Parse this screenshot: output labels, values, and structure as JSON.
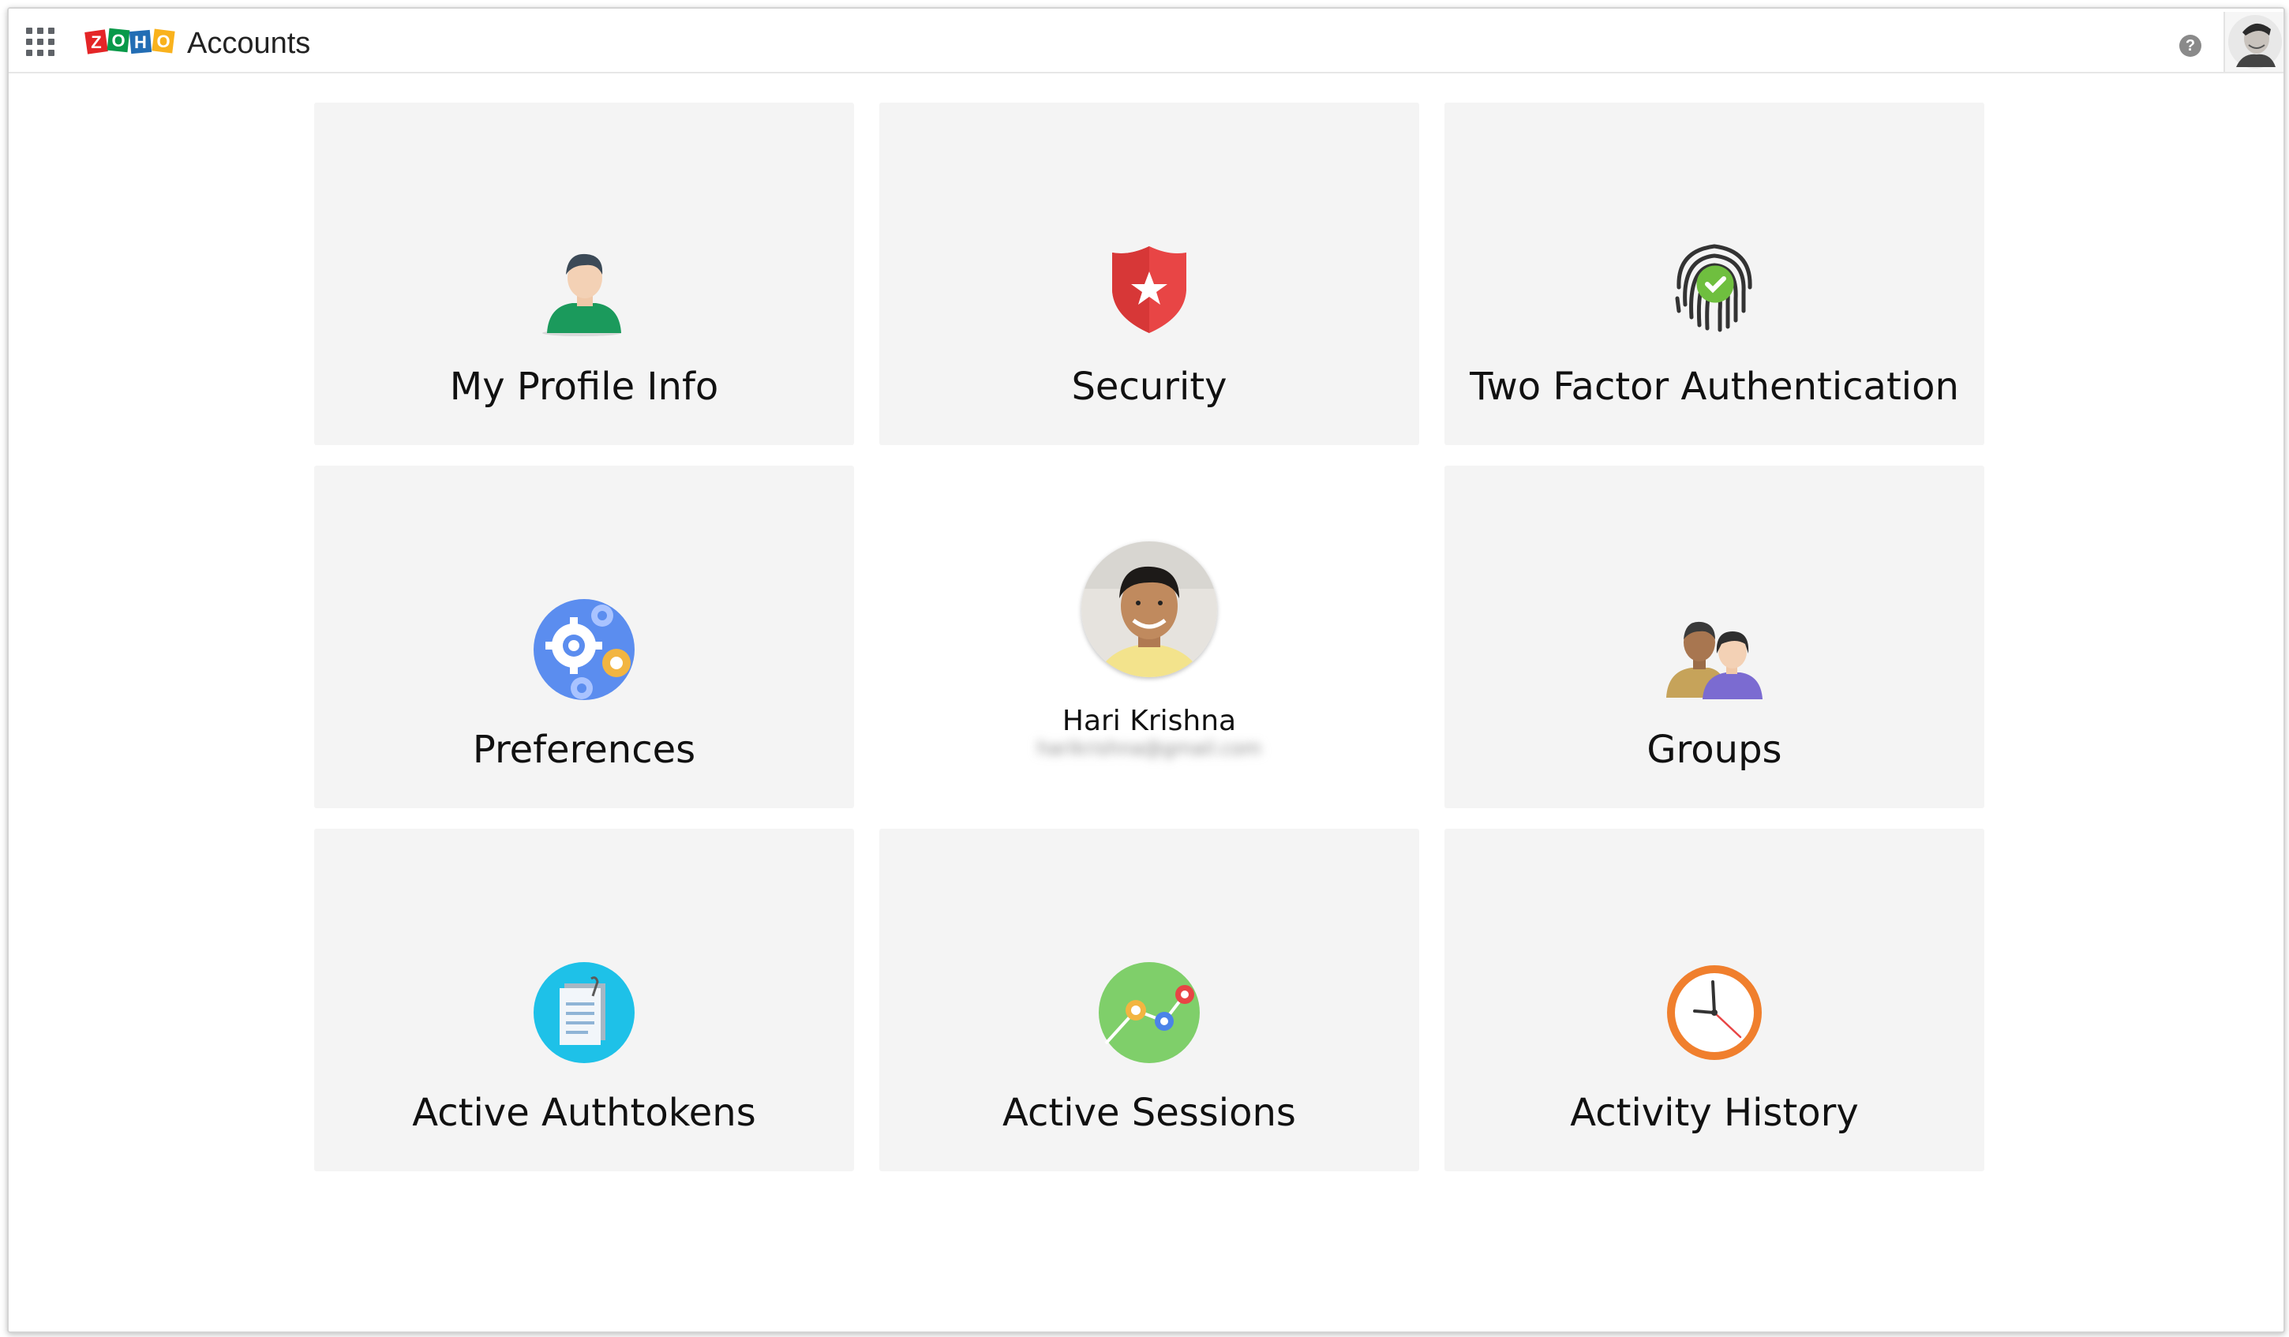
{
  "header": {
    "app_name": "Accounts",
    "logo_letters": [
      "Z",
      "O",
      "H",
      "O"
    ],
    "logo_colors": [
      "#e42527",
      "#089949",
      "#226db4",
      "#f9b21d"
    ],
    "help_glyph": "?"
  },
  "tiles": {
    "profile_info": {
      "label": "My Profile Info",
      "icon": "user-icon"
    },
    "security": {
      "label": "Security",
      "icon": "shield-star-icon"
    },
    "two_factor": {
      "label": "Two Factor Authentication",
      "icon": "fingerprint-check-icon"
    },
    "preferences": {
      "label": "Preferences",
      "icon": "gears-icon"
    },
    "groups": {
      "label": "Groups",
      "icon": "group-icon"
    },
    "authtokens": {
      "label": "Active Authtokens",
      "icon": "notepad-icon"
    },
    "sessions": {
      "label": "Active Sessions",
      "icon": "sessions-graph-icon"
    },
    "activity": {
      "label": "Activity History",
      "icon": "clock-icon"
    }
  },
  "profile": {
    "name": "Hari Krishna",
    "email": "harikrishna@gmail.com"
  },
  "colors": {
    "card_bg": "#f4f4f4",
    "shield_red": "#e84545",
    "pref_blue": "#5b8def",
    "sessions_green": "#7fcf6a",
    "clock_orange": "#f07f2d",
    "token_cyan": "#1ec1e8"
  }
}
